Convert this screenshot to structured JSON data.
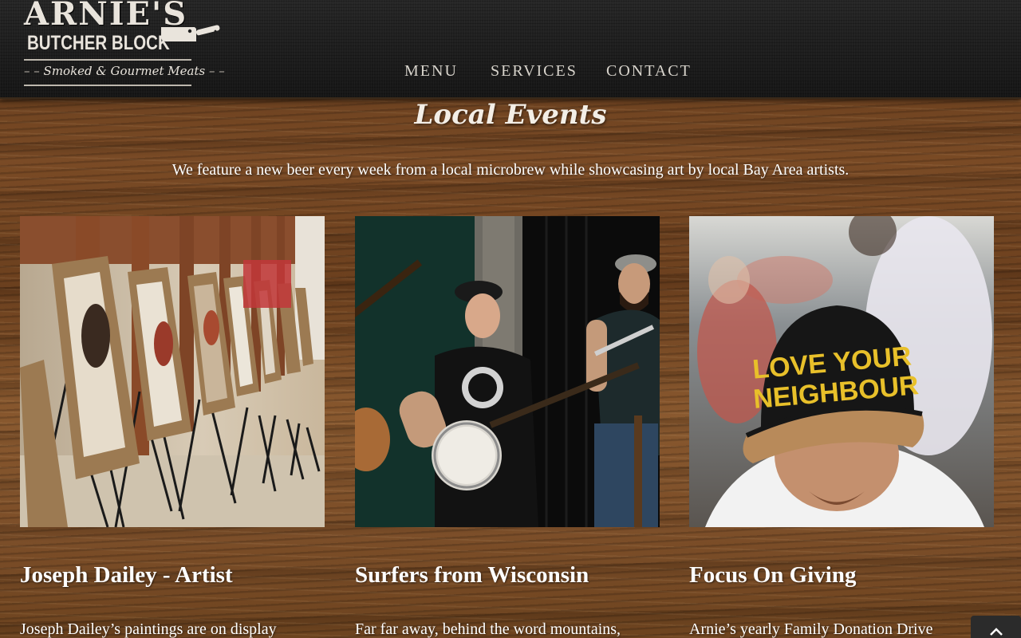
{
  "brand": {
    "name_line1": "ARNIE'S",
    "name_line2": "BUTCHER BLOCK",
    "tagline": "Smoked & Gourmet Meats",
    "logo_icon": "cleaver-icon"
  },
  "nav": {
    "items": [
      {
        "label": "MENU"
      },
      {
        "label": "SERVICES"
      },
      {
        "label": "CONTACT"
      }
    ]
  },
  "section": {
    "title": "Local Events",
    "intro": "We feature a new beer every week from a local microbrew while showcasing art by local Bay Area artists."
  },
  "events": [
    {
      "title": "Joseph Dailey - Artist",
      "text": "Joseph Dailey’s paintings are on display",
      "image": "art-gallery-easels-photo"
    },
    {
      "title": "Surfers from Wisconsin",
      "text": "Far far away, behind the word mountains,",
      "image": "band-banjo-guitar-photo"
    },
    {
      "title": "Focus On Giving",
      "text": "Arnie’s yearly Family Donation Drive",
      "image": "love-your-neighbour-cap-photo",
      "cap_text_line1": "LOVE YOUR",
      "cap_text_line2": "NEIGHBOUR"
    }
  ],
  "scroll_top": {
    "icon": "chevron-up-icon"
  },
  "colors": {
    "header_bg": "#1e1e1e",
    "wood": "#6b4222",
    "text": "#ffffff",
    "cap_gold": "#e8c02a"
  }
}
